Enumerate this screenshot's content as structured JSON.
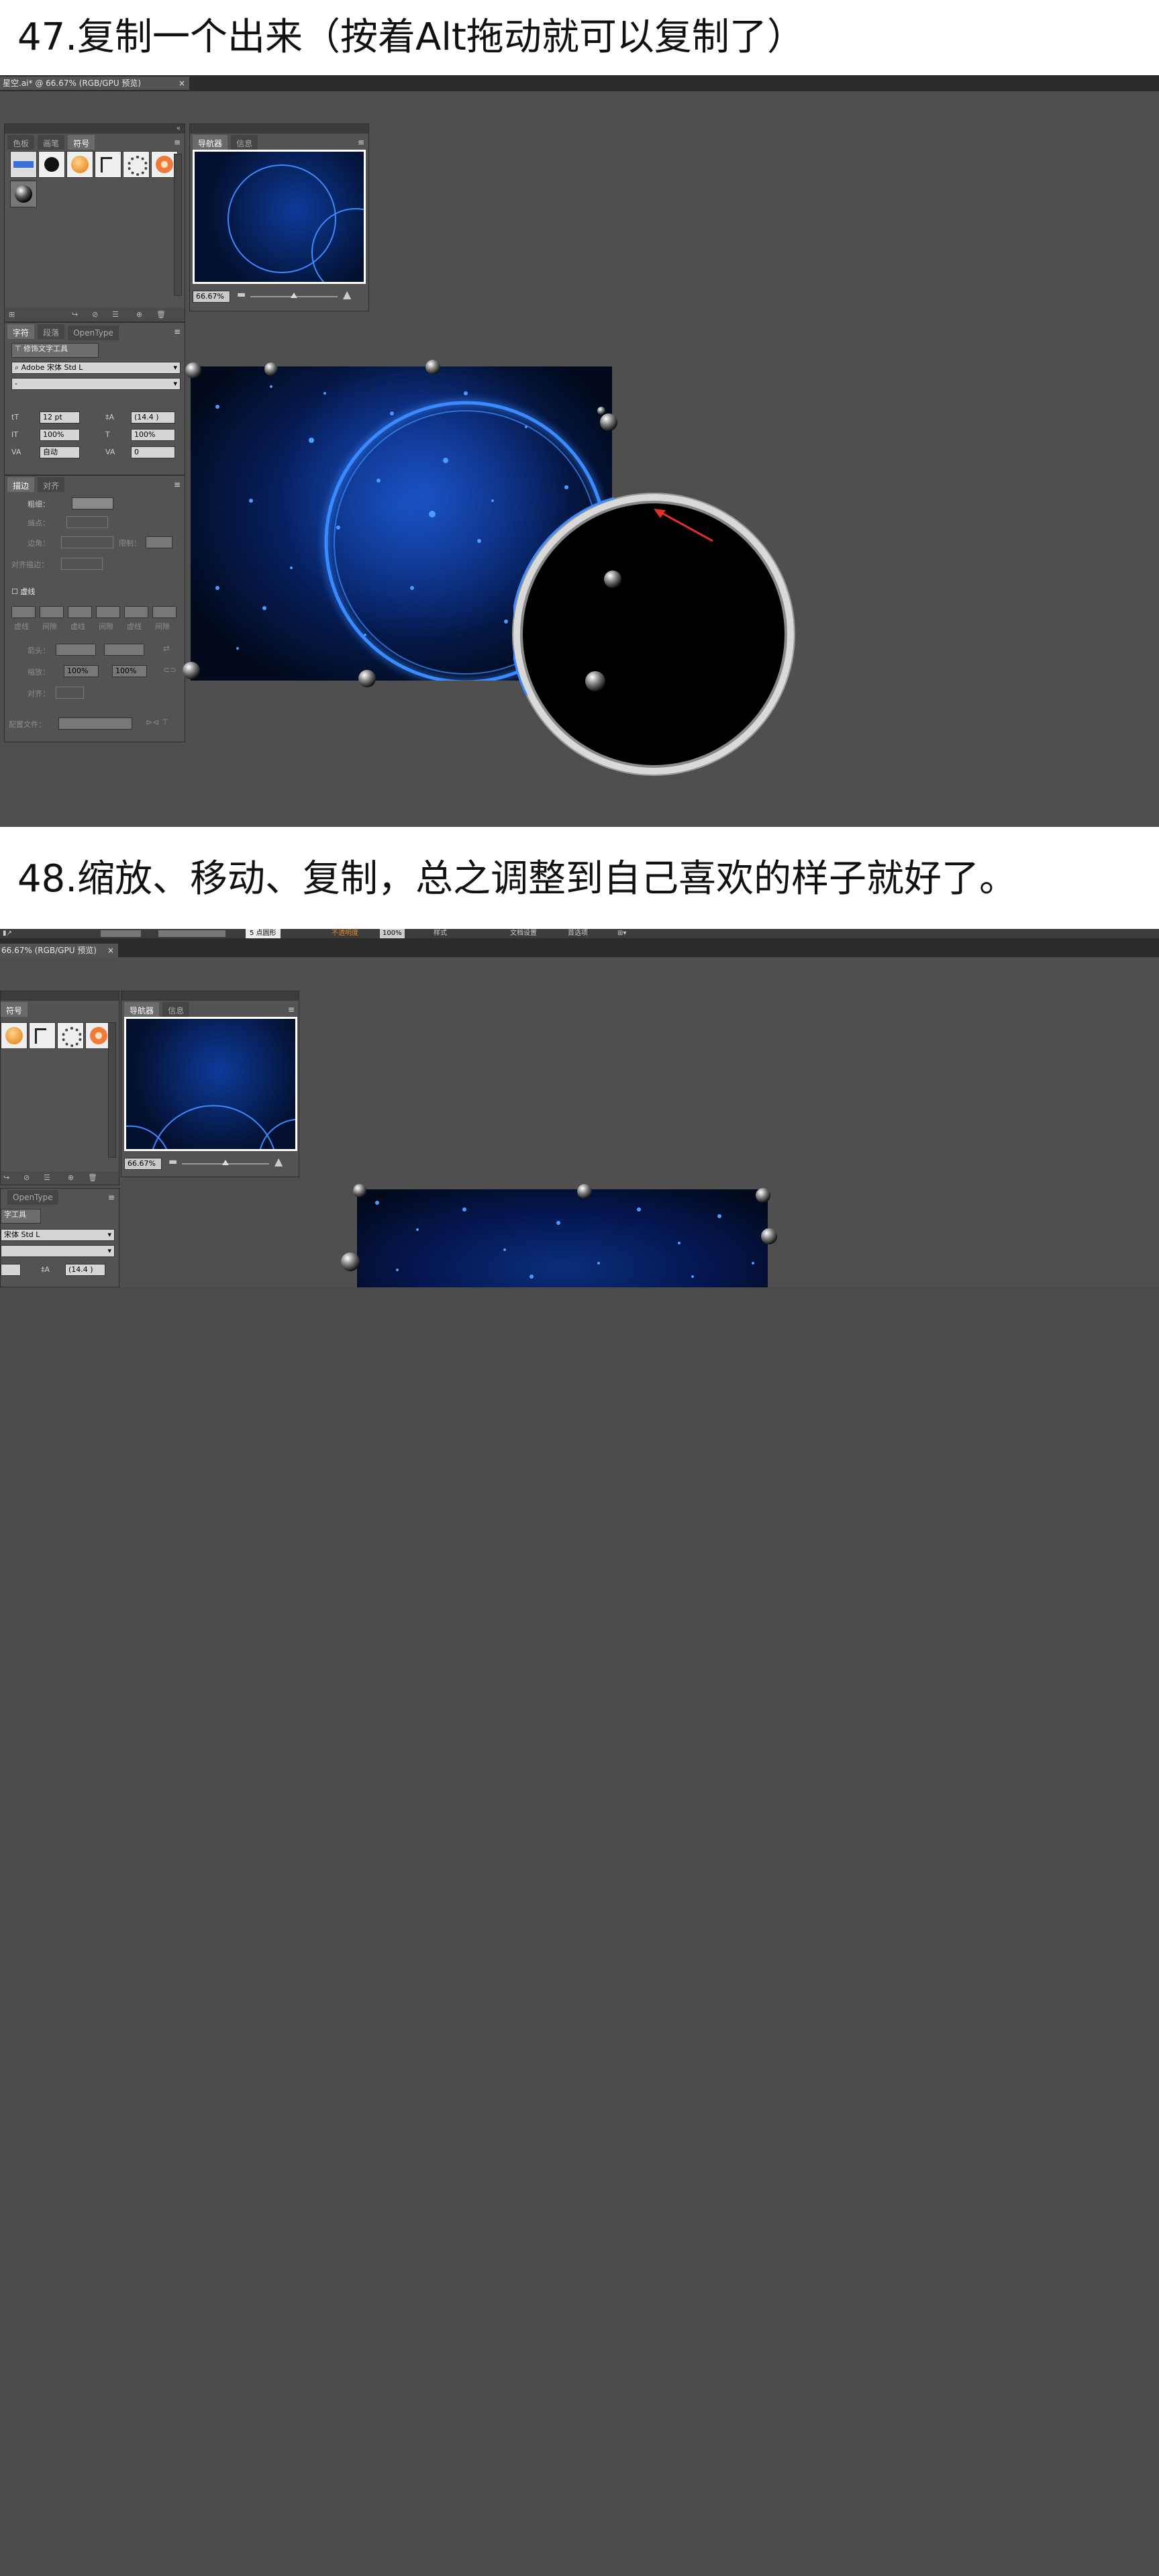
{
  "step47": {
    "title": "47.复制一个出来（按着Alt拖动就可以复制了）",
    "doc_tab": "星空.ai* @ 66.67% (RGB/GPU 预览)",
    "symbols_panel": {
      "tabs": [
        "色板",
        "画笔",
        "符号"
      ]
    },
    "navigator_panel": {
      "tabs": [
        "导航器",
        "信息"
      ],
      "zoom": "66.67%"
    },
    "char_panel": {
      "tabs": [
        "字符",
        "段落",
        "OpenType"
      ],
      "touch_tool": "修饰文字工具",
      "font": "Adobe 宋体 Std L",
      "style": "-",
      "size": "12 pt",
      "leading": "(14.4 )",
      "hscale": "100%",
      "vscale": "100%",
      "kerning": "自动",
      "tracking": "0"
    },
    "stroke_panel": {
      "tabs": [
        "描边",
        "对齐"
      ],
      "weight_label": "粗细：",
      "cap_label": "端点：",
      "corner_label": "边角：",
      "limit_label": "限制：",
      "align_label": "对齐描边：",
      "dashed_label": "虚线",
      "dash_labels": [
        "虚线",
        "间隙",
        "虚线",
        "间隙",
        "虚线",
        "间隙"
      ],
      "arrow_label": "箭头：",
      "scale_label": "缩放：",
      "scale_a": "100%",
      "scale_b": "100%",
      "align2_label": "对齐：",
      "profile_label": "配置文件："
    }
  },
  "step48": {
    "title": "48.缩放、移动、复制，总之调整到自己喜欢的样子就好了。",
    "doc_tab": "66.67% (RGB/GPU 预览)",
    "toolbar": {
      "shape": "5 点圆形",
      "opacity_label": "不透明度",
      "opacity": "100%",
      "style_label": "样式",
      "docsetup": "文档设置",
      "prefs": "首选项"
    },
    "symbols_panel": {
      "tabs": [
        "符号"
      ]
    },
    "navigator_panel": {
      "tabs": [
        "导航器",
        "信息"
      ],
      "zoom": "66.67%"
    },
    "char_panel": {
      "tabs": [
        "OpenType"
      ],
      "touch_tool": "字工具",
      "font": "宋体 Std L",
      "leading": "(14.4 )"
    }
  },
  "colors": {
    "panel": "#535353",
    "canvas": "#4a4a4a",
    "space": "#020a1c",
    "glow": "#3a8bff",
    "arrow": "#e0302a"
  }
}
